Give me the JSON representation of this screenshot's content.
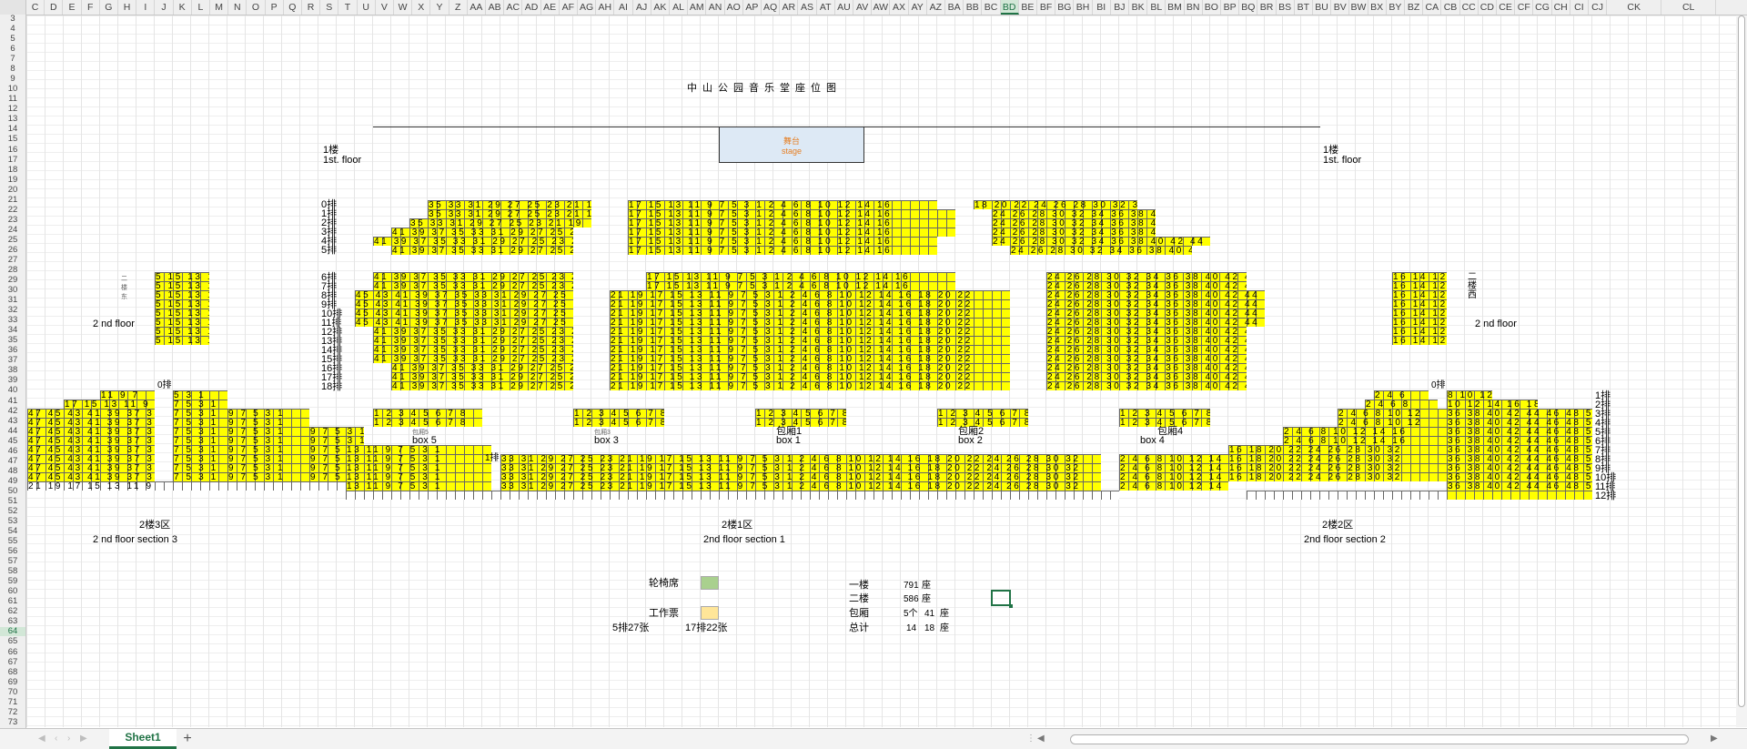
{
  "columns": [
    "C",
    "D",
    "E",
    "F",
    "G",
    "H",
    "I",
    "J",
    "K",
    "L",
    "M",
    "N",
    "O",
    "P",
    "Q",
    "R",
    "S",
    "T",
    "U",
    "V",
    "W",
    "X",
    "Y",
    "Z",
    "AA",
    "AB",
    "AC",
    "AD",
    "AE",
    "AF",
    "AG",
    "AH",
    "AI",
    "AJ",
    "AK",
    "AL",
    "AM",
    "AN",
    "AO",
    "AP",
    "AQ",
    "AR",
    "AS",
    "AT",
    "AU",
    "AV",
    "AW",
    "AX",
    "AY",
    "AZ",
    "BA",
    "BB",
    "BC",
    "BD",
    "BE",
    "BF",
    "BG",
    "BH",
    "BI",
    "BJ",
    "BK",
    "BL",
    "BM",
    "BN",
    "BO",
    "BP",
    "BQ",
    "BR",
    "BS",
    "BT",
    "BU",
    "BV",
    "BW",
    "BX",
    "BY",
    "BZ",
    "CA",
    "CB",
    "CC",
    "CD",
    "CE",
    "CF",
    "CG",
    "CH",
    "CI",
    "CJ",
    "CK",
    "CL"
  ],
  "selected_column": "BD",
  "rows_start": 3,
  "rows_end": 73,
  "selected_row": 64,
  "sheet": {
    "title": "中山公园音乐堂座位图",
    "stage_cn": "舞台",
    "stage_en": "stage"
  },
  "labels": {
    "floor1_left_cn": "1楼",
    "floor1_left_en": "1st. floor",
    "floor1_right_cn": "1楼",
    "floor1_right_en": "1st. floor",
    "floor2_left": "2 nd floor",
    "floor2_right": "2 nd floor",
    "floor2_left_vertical": "二楼东",
    "floor2_right_vertical": "二楼西",
    "sec3_cn": "2楼3区",
    "sec3_en": "2 nd floor    section    3",
    "sec1_cn": "2楼1区",
    "sec1_en": "2nd    floor    section    1",
    "sec2_cn": "2楼2区",
    "sec2_en": "2nd    floor    section    2",
    "box5": "box    5",
    "box3": "box    3",
    "box1": "box    1",
    "box2": "box    2",
    "box4": "box    4",
    "box1_cn": "包厢1",
    "box2_cn": "包厢2",
    "box4_cn": "包厢4",
    "box5_cn": "包厢5",
    "box3_cn": "包厢3",
    "row_0l": "0排",
    "row_1_0": "1排"
  },
  "row_labels_first": [
    "0排",
    "1排",
    "2排",
    "3排",
    "4排",
    "5排"
  ],
  "row_labels_second": [
    "6排",
    "7排",
    "8排",
    "9排",
    "10排",
    "11排",
    "12排",
    "13排",
    "14排",
    "15排",
    "16排",
    "17排",
    "18排"
  ],
  "right_row_labels": [
    "1排",
    "2排",
    "3排",
    "4排",
    "5排",
    "6排",
    "7排",
    "8排",
    "9排",
    "10排",
    "11排",
    "12排"
  ],
  "legend": {
    "wheelchair": "轮椅席",
    "wheelchair_color": "#a9d08e",
    "staff": "工作票",
    "staff_color": "#ffe699",
    "staff_note1": "5排27张",
    "staff_note2": "17排22张"
  },
  "totals": {
    "f1_label": "一楼",
    "f1_value": "791",
    "f1_unit": "座",
    "f2_label": "二楼",
    "f2_value": "586",
    "f2_unit": "座",
    "box_label": "包厢",
    "box_count": "5个",
    "box_value": "41",
    "box_unit": "座",
    "total_label": "总计",
    "total_a": "14",
    "total_b": "18",
    "total_unit": "座"
  },
  "seat_rows": {
    "front_left": "35 33 31 29 27 25 23 21 19",
    "front_center": "17 15 13 11 9 7 5 3 1 2 4 6 8 10 12 14 16",
    "front_right": "18 20 22 24 26 28 30 32 34",
    "left_wide": "41 39 37 35 33 31 29 27 25 23 21",
    "left_block": "45 43 41 39 37 35 33 31 29 27 25 23",
    "center_block": "21 19 17 15 13 11 9 7 5 3 1 2 4 6 8 10 12 14 16 18 20 22",
    "right_block": "24 26 28 30 32 34 36 38 40 42 44 46",
    "sec3_row": "47 45 43 41 39 37 35",
    "sec1_row": "33 31 29 27 25 23 21 19 17 15 13 11 9 7 5 3 1 2 4 6 8 10 12 14 16 18 20 22 24 26 28 30 32",
    "sec2_row": "36 38 40 42 44 46 48 50"
  },
  "bottom": {
    "sheet_tab": "Sheet1",
    "add_tab": "+"
  },
  "colors": {
    "seat": "#ffff00",
    "excel_green": "#217346"
  }
}
